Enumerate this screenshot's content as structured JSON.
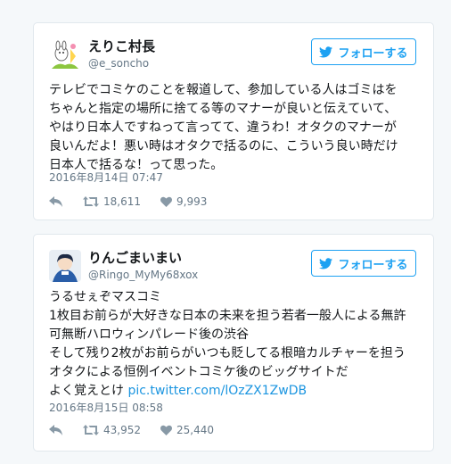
{
  "tweets": [
    {
      "display_name": "えりこ村長",
      "handle": "@e_soncho",
      "follow_label": "フォローする",
      "lines": [
        "テレビでコミケのことを報道して、参加している人はゴミはを",
        "ちゃんと指定の場所に捨てる等のマナーが良いと伝えていて、",
        "やはり日本人ですねって言ってて、違うわ！オタクのマナーが",
        "良いんだよ！悪い時はオタクで括るのに、こういう良い時だけ",
        "日本人で括るな！って思った。"
      ],
      "date": "2016年8月14日 07:47",
      "retweets": "18,611",
      "likes": "9,993"
    },
    {
      "display_name": "りんごまいまい",
      "handle": "@Ringo_MyMy68xox",
      "follow_label": "フォローする",
      "lines": [
        "うるせぇぞマスコミ",
        "1枚目お前らが大好きな日本の未来を担う若者一般人による無許",
        "可無断ハロウィンパレード後の渋谷",
        "そして残り2枚がお前らがいつも貶してる根暗カルチャーを担う",
        "オタクによる恒例イベントコミケ後のビッグサイトだ"
      ],
      "last_line_text": "よく覚えとけ",
      "link": "pic.twitter.com/lOzZX1ZwDB",
      "date": "2016年8月15日 08:58",
      "retweets": "43,952",
      "likes": "25,440"
    }
  ],
  "icons": {
    "follow": "twitter-bird-icon",
    "reply": "reply-icon",
    "retweet": "retweet-icon",
    "like": "heart-icon"
  },
  "colors": {
    "accent": "#1da1f2",
    "link": "#1b95e0",
    "muted": "#657786",
    "border": "#e1e8ed",
    "background": "#f5f8fa"
  }
}
